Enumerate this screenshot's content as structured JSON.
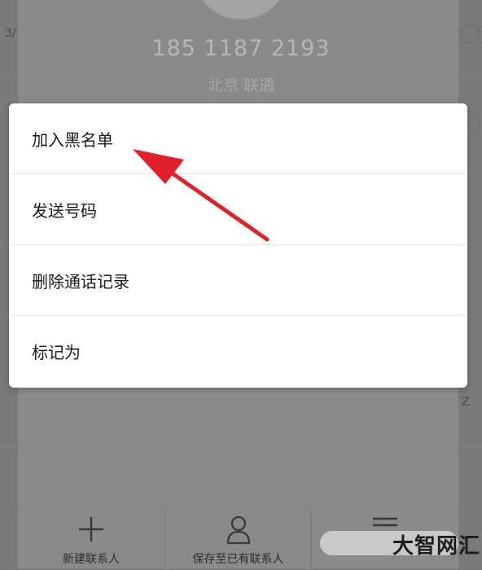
{
  "contact": {
    "phone_number": "185 1187 2193",
    "location": "北京 联通"
  },
  "background_edges": {
    "left_fragment": "3/",
    "right_fragment": "Z"
  },
  "menu": {
    "items": [
      {
        "label": "加入黑名单"
      },
      {
        "label": "发送号码"
      },
      {
        "label": "删除通话记录"
      },
      {
        "label": "标记为"
      }
    ]
  },
  "toolbar": {
    "new_contact": {
      "label": "新建联系人",
      "icon": "plus-icon"
    },
    "save_existing": {
      "label": "保存至已有联系人",
      "icon": "person-icon"
    },
    "more": {
      "label": "",
      "icon": "menu-lines-icon"
    }
  },
  "watermark": {
    "text": "大智网汇"
  },
  "annotation": {
    "icon": "red-arrow",
    "color": "#e0202a"
  }
}
